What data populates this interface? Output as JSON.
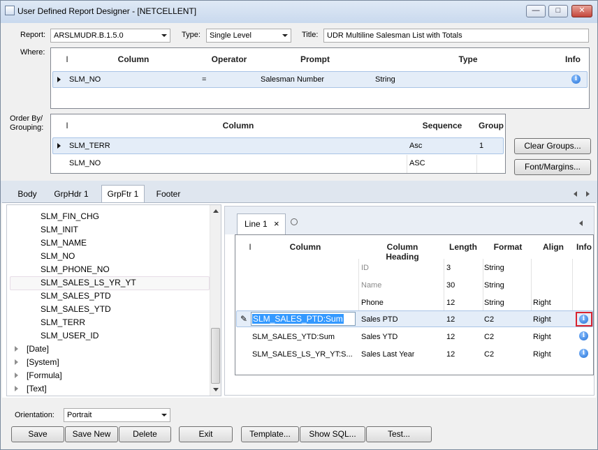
{
  "window": {
    "title": "User Defined Report Designer - [NETCELLENT]"
  },
  "header": {
    "report_label": "Report:",
    "report_value": "ARSLMUDR.B.1.5.0",
    "type_label": "Type:",
    "type_value": "Single Level",
    "title_label": "Title:",
    "title_value": "UDR Multiline Salesman List with Totals"
  },
  "where": {
    "label": "Where:",
    "columns": [
      "Column",
      "Operator",
      "Prompt",
      "Type",
      "Info"
    ],
    "rows": [
      {
        "column": "SLM_NO",
        "operator": "=",
        "prompt": "Salesman Number",
        "type": "String"
      }
    ]
  },
  "orderby": {
    "label_line1": "Order By/",
    "label_line2": "Grouping:",
    "columns": [
      "Column",
      "Sequence",
      "Group"
    ],
    "rows": [
      {
        "column": "SLM_TERR",
        "sequence": "Asc",
        "group": "1"
      },
      {
        "column": "SLM_NO",
        "sequence": "ASC",
        "group": ""
      }
    ]
  },
  "side_buttons": {
    "clear_groups": "Clear Groups...",
    "font_margins": "Font/Margins..."
  },
  "tabs": [
    "Body",
    "GrpHdr 1",
    "GrpFtr 1",
    "Footer"
  ],
  "tree": {
    "fields": [
      "SLM_FIN_CHG",
      "SLM_INIT",
      "SLM_NAME",
      "SLM_NO",
      "SLM_PHONE_NO",
      "SLM_SALES_LS_YR_YT",
      "SLM_SALES_PTD",
      "SLM_SALES_YTD",
      "SLM_TERR",
      "SLM_USER_ID"
    ],
    "groups": [
      "[Date]",
      "[System]",
      "[Formula]",
      "[Text]"
    ]
  },
  "line_tab": {
    "label": "Line 1",
    "close": "×"
  },
  "lines": {
    "columns": [
      "Column",
      "Column Heading",
      "Length",
      "Format",
      "Align",
      "Info"
    ],
    "rows": [
      {
        "column": "",
        "heading": "ID",
        "length": "3",
        "format": "String",
        "align": ""
      },
      {
        "column": "",
        "heading": "Name",
        "length": "30",
        "format": "String",
        "align": ""
      },
      {
        "column": "",
        "heading": "Phone",
        "length": "12",
        "format": "String",
        "align": "Right"
      },
      {
        "column": "SLM_SALES_PTD:Sum",
        "heading": "Sales PTD",
        "length": "12",
        "format": "C2",
        "align": "Right"
      },
      {
        "column": "SLM_SALES_YTD:Sum",
        "heading": "Sales YTD",
        "length": "12",
        "format": "C2",
        "align": "Right"
      },
      {
        "column": "SLM_SALES_LS_YR_YT:S...",
        "heading": "Sales Last Year",
        "length": "12",
        "format": "C2",
        "align": "Right"
      }
    ]
  },
  "footer": {
    "orientation_label": "Orientation:",
    "orientation_value": "Portrait",
    "save": "Save",
    "save_new": "Save New",
    "delete": "Delete",
    "exit": "Exit",
    "template": "Template...",
    "show_sql": "Show SQL...",
    "test": "Test..."
  },
  "colors": {
    "selection": "#e4edf8",
    "highlight_border": "#d9232e",
    "info_blue": "#1e6ed6"
  }
}
